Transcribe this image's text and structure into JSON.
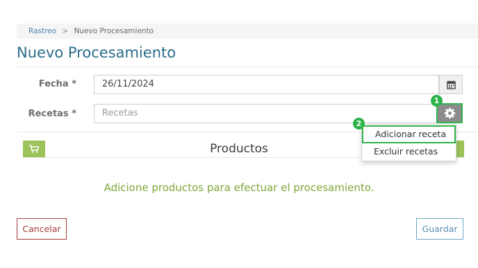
{
  "breadcrumb": {
    "root": "Rastreo",
    "separator": ">",
    "current": "Nuevo Procesamiento"
  },
  "page_title": "Nuevo Procesamiento",
  "form": {
    "fecha": {
      "label": "Fecha *",
      "value": "26/11/2024",
      "icon": "calendar-icon"
    },
    "recetas": {
      "label": "Recetas *",
      "placeholder": "Recetas",
      "icon": "gear-icon"
    }
  },
  "dropdown": {
    "items": [
      {
        "label": "Adicionar receta"
      },
      {
        "label": "Excluir recetas"
      }
    ]
  },
  "badges": {
    "one": "1",
    "two": "2"
  },
  "products": {
    "title": "Productos",
    "empty_message": "Adicione productos para efectuar el procesamiento.",
    "icon": "cart-icon"
  },
  "actions": {
    "cancel": "Cancelar",
    "save": "Guardar"
  },
  "colors": {
    "accent_green": "#2db34a",
    "title_blue": "#2a6c8a",
    "cancel_red": "#a33a3a",
    "save_blue": "#6aa6c6",
    "message_green": "#7fa83a",
    "cart_green": "#9cc25a"
  }
}
